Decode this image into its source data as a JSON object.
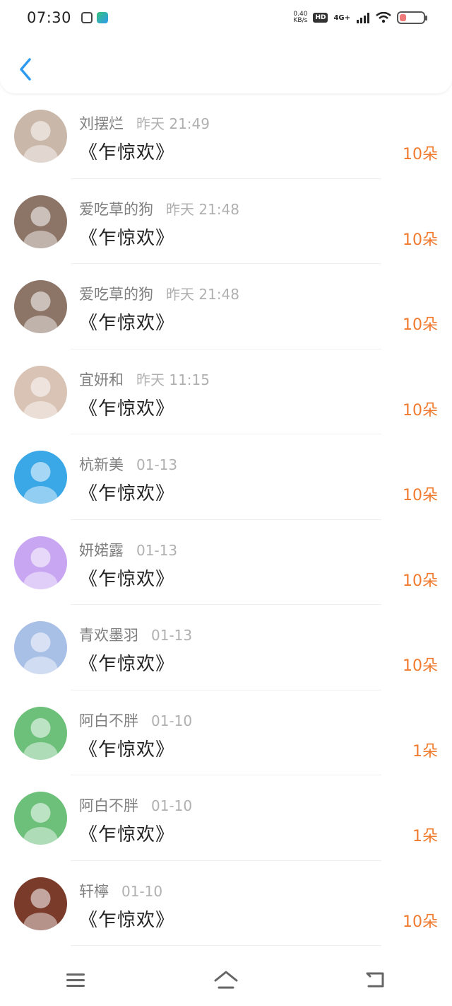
{
  "status_bar": {
    "time": "07:30",
    "net_speed_value": "0.40",
    "net_speed_unit": "KB/s",
    "hd": "HD",
    "network": "4G+",
    "battery_level_percent": 28
  },
  "header": {
    "back_icon": "chevron-left-icon"
  },
  "items": [
    {
      "name": "刘摆烂",
      "time": "昨天 21:49",
      "gift": "《乍惊欢》",
      "count": "10朵",
      "avatar_color": "#c9b7a9"
    },
    {
      "name": "爱吃草的狗",
      "time": "昨天 21:48",
      "gift": "《乍惊欢》",
      "count": "10朵",
      "avatar_color": "#8c7567"
    },
    {
      "name": "爱吃草的狗",
      "time": "昨天 21:48",
      "gift": "《乍惊欢》",
      "count": "10朵",
      "avatar_color": "#8c7567"
    },
    {
      "name": "宜妍和",
      "time": "昨天 11:15",
      "gift": "《乍惊欢》",
      "count": "10朵",
      "avatar_color": "#d9c3b4"
    },
    {
      "name": "杭新美",
      "time": "01-13",
      "gift": "《乍惊欢》",
      "count": "10朵",
      "avatar_color": "#3aa7e6"
    },
    {
      "name": "妍婼露",
      "time": "01-13",
      "gift": "《乍惊欢》",
      "count": "10朵",
      "avatar_color": "#c9a6f2"
    },
    {
      "name": "青欢墨羽",
      "time": "01-13",
      "gift": "《乍惊欢》",
      "count": "10朵",
      "avatar_color": "#a8bfe6"
    },
    {
      "name": "阿白不胖",
      "time": "01-10",
      "gift": "《乍惊欢》",
      "count": "1朵",
      "avatar_color": "#6cc07a"
    },
    {
      "name": "阿白不胖",
      "time": "01-10",
      "gift": "《乍惊欢》",
      "count": "1朵",
      "avatar_color": "#6cc07a"
    },
    {
      "name": "轩檸",
      "time": "01-10",
      "gift": "《乍惊欢》",
      "count": "10朵",
      "avatar_color": "#7a3b2a"
    }
  ],
  "nav_bar": {
    "menu_icon": "menu-icon",
    "home_icon": "home-icon",
    "back_icon": "return-icon"
  },
  "colors": {
    "accent_back": "#2f9bf0",
    "count_orange": "#f07a2e",
    "name_gray": "#7f7f7f",
    "time_gray": "#b0b0b0"
  }
}
